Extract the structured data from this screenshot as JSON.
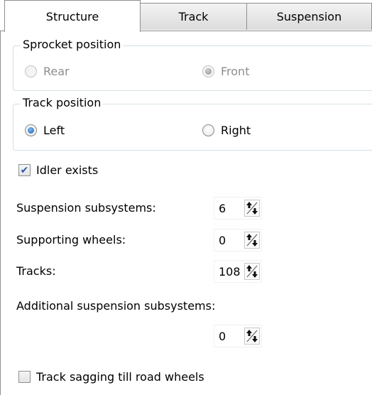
{
  "tabs": {
    "structure": "Structure",
    "track": "Track",
    "suspension": "Suspension"
  },
  "sprocket_group": {
    "title": "Sprocket position",
    "options": [
      {
        "label": "Rear",
        "checked": false,
        "enabled": false
      },
      {
        "label": "Front",
        "checked": true,
        "enabled": false
      }
    ]
  },
  "track_group": {
    "title": "Track position",
    "options": [
      {
        "label": "Left",
        "checked": true,
        "enabled": true
      },
      {
        "label": "Right",
        "checked": false,
        "enabled": true
      }
    ]
  },
  "idler": {
    "label": "Idler exists",
    "checked": true
  },
  "fields": {
    "suspension_subsystems": {
      "label": "Suspension subsystems:",
      "value": "6"
    },
    "supporting_wheels": {
      "label": "Supporting wheels:",
      "value": "0"
    },
    "tracks": {
      "label": "Tracks:",
      "value": "108"
    },
    "additional_suspension": {
      "label": "Additional suspension subsystems:",
      "value": "0"
    }
  },
  "sagging": {
    "label": "Track sagging till road wheels",
    "checked": false
  }
}
